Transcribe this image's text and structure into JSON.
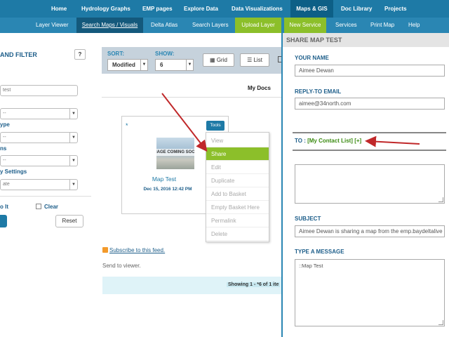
{
  "top_nav": {
    "items": [
      "Home",
      "Hydrology Graphs",
      "EMP pages",
      "Explore Data",
      "Data Visualizations",
      "Maps & GIS",
      "Doc Library",
      "Projects"
    ],
    "active": "Maps & GIS"
  },
  "sub_nav": {
    "items": [
      "Layer Viewer",
      "Search Maps / Visuals",
      "Delta Atlas",
      "Search Layers",
      "Upload Layer",
      "New Service",
      "Services",
      "Print Map",
      "Help"
    ],
    "active": "Search Maps / Visuals"
  },
  "filter": {
    "title": "AND FILTER",
    "help_label": "?",
    "search_value": "test",
    "labels": [
      "ype",
      "ns",
      "y Settings"
    ],
    "selects": [
      "--",
      "--",
      "--",
      "ate"
    ],
    "to_it_label": "o It",
    "clear_label": "Clear",
    "reset_label": "Reset"
  },
  "toolbar": {
    "sort_label": "SORT:",
    "sort_value": "Modified",
    "show_label": "SHOW:",
    "show_value": "6",
    "grid_label": "Grid",
    "list_label": "List"
  },
  "results": {
    "my_docs_label": "My Docs",
    "card": {
      "star": "*",
      "tools_label": "Tools",
      "thumb_text": "IMAGE COMING SOON",
      "title": "Map Test",
      "date": "Dec 15, 2016 12:42 PM"
    },
    "menu": [
      "View",
      "Share",
      "Edit",
      "Duplicate",
      "Add to Basket",
      "Empty Basket Here",
      "Permalink",
      "Delete"
    ],
    "menu_active": "Share",
    "subscribe_label": "Subscribe to this feed.",
    "send_to_viewer": "Send to viewer.",
    "showing": "Showing 1 - *6 of 1 ite"
  },
  "share": {
    "header": "SHARE MAP TEST",
    "your_name_label": "YOUR NAME",
    "your_name_value": "Aimee Dewan",
    "reply_to_label": "REPLY-TO EMAIL",
    "reply_to_value": "aimee@34north.com",
    "to_prefix": "TO : ",
    "to_contact_list": "[My Contact List]",
    "to_add": "[+]",
    "subject_label": "SUBJECT",
    "subject_value": "Aimee Dewan is sharing a map from the emp.baydeltalive",
    "message_label": "TYPE A MESSAGE",
    "message_value": "::Map Test"
  },
  "colors": {
    "nav_blue": "#1e7aa6",
    "nav_active": "#0d5f86",
    "accent_green": "#8cbf2a",
    "label_blue": "#1d5e8a",
    "annotation_arrow": "#c0282a"
  }
}
